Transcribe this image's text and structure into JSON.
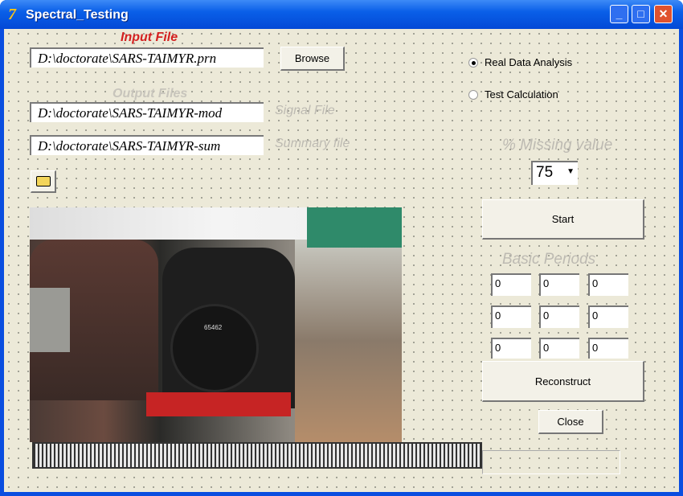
{
  "window": {
    "title": "Spectral_Testing",
    "logo": "7"
  },
  "input": {
    "label": "Input File",
    "path": "D:\\doctorate\\SARS-TAIMYR.prn",
    "browse": "Browse"
  },
  "output": {
    "label": "Output Files",
    "signal_path": "D:\\doctorate\\SARS-TAIMYR-mod",
    "signal_label": "Signal File",
    "summary_path": "D:\\doctorate\\SARS-TAIMYR-sum",
    "summary_label": "Summary file"
  },
  "mode": {
    "real": "Real Data Analysis",
    "test": "Test Calculation",
    "selected": "real"
  },
  "missing": {
    "label": "% Missing value",
    "value": "75"
  },
  "start": "Start",
  "periods": {
    "label": "Basic Periods",
    "values": [
      "0",
      "0",
      "0",
      "0",
      "0",
      "0",
      "0",
      "0",
      "0"
    ]
  },
  "reconstruct": "Reconstruct",
  "close": "Close",
  "photo": {
    "plate": "65462"
  }
}
